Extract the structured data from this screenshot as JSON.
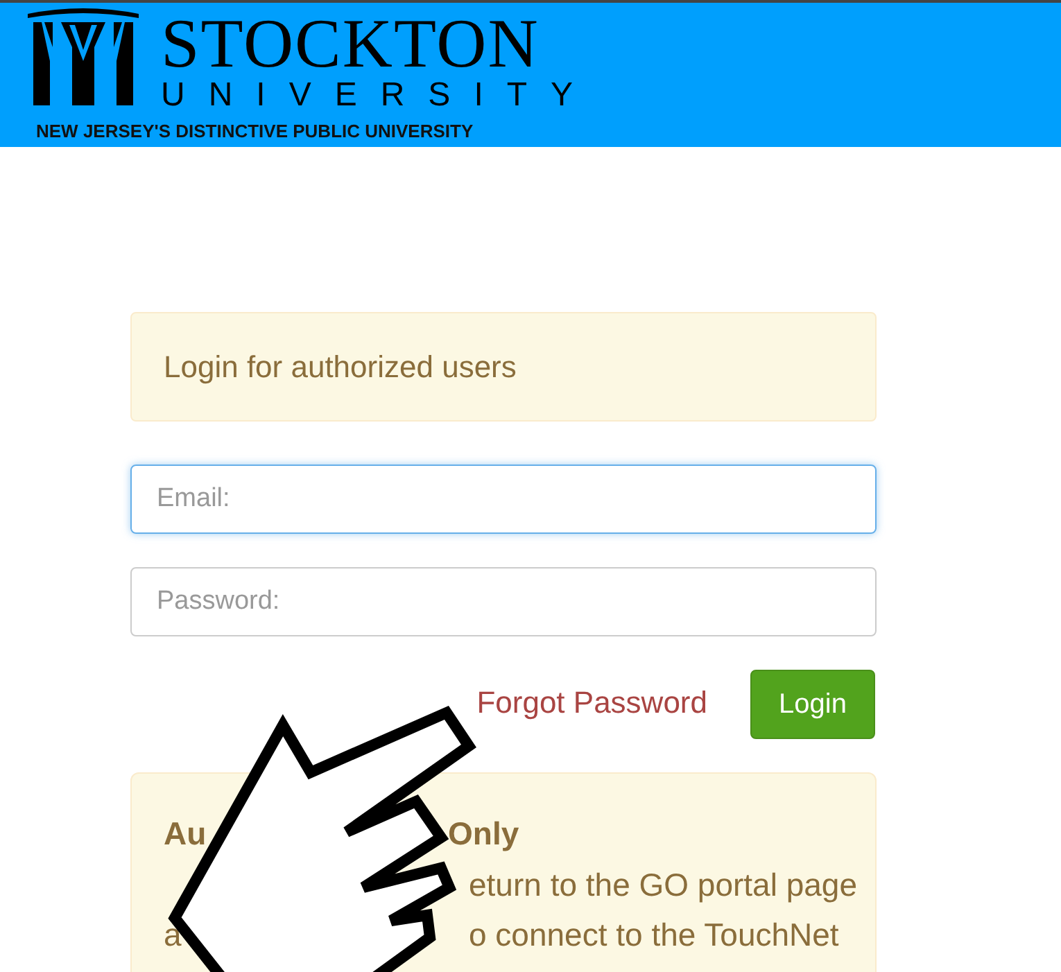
{
  "header": {
    "title": "STOCKTON",
    "subtitle": "UNIVERSITY",
    "tagline": "NEW JERSEY'S DISTINCTIVE PUBLIC UNIVERSITY"
  },
  "alert": {
    "text": "Login for authorized users"
  },
  "fields": [
    {
      "placeholder": "Email:",
      "focused": true
    },
    {
      "placeholder": "Password:",
      "focused": false
    }
  ],
  "forgot_link": "Forgot Password",
  "login_button": "Login",
  "notice": {
    "heading": [
      "Au",
      "Only"
    ],
    "lines": [
      {
        "right": "eturn to the GO portal page"
      },
      {
        "left": "a",
        "right": "o connect to the TouchNet"
      }
    ]
  }
}
